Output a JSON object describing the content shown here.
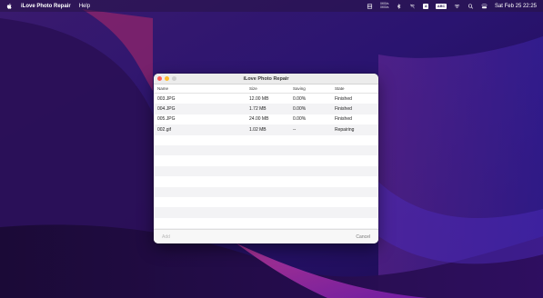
{
  "menubar": {
    "app_name": "iLove Photo Repair",
    "menu_help": "Help",
    "net_up": "0KB/s",
    "net_down": "0KB/s",
    "input_badge": "A",
    "battery_badge": "ABC",
    "datetime": "Sat Feb 25  22:25"
  },
  "window": {
    "title": "iLove Photo Repair",
    "columns": {
      "name": "Name",
      "size": "Size",
      "saving": "Saving",
      "state": "State"
    },
    "files": [
      {
        "name": "003.JPG",
        "size": "12.00 MB",
        "saving": "0.00%",
        "state": "Finished"
      },
      {
        "name": "004.JPG",
        "size": "1.72 MB",
        "saving": "0.00%",
        "state": "Finished"
      },
      {
        "name": "005.JPG",
        "size": "24.00 MB",
        "saving": "0.00%",
        "state": "Finished"
      },
      {
        "name": "002.gif",
        "size": "1.02 MB",
        "saving": "--",
        "state": "Repairing"
      }
    ],
    "add_label": "Add",
    "cancel_label": "Cancel"
  },
  "colors": {
    "close": "#ff5f57",
    "minimize": "#febc2e",
    "zoom_inactive": "#cfcfcf"
  }
}
